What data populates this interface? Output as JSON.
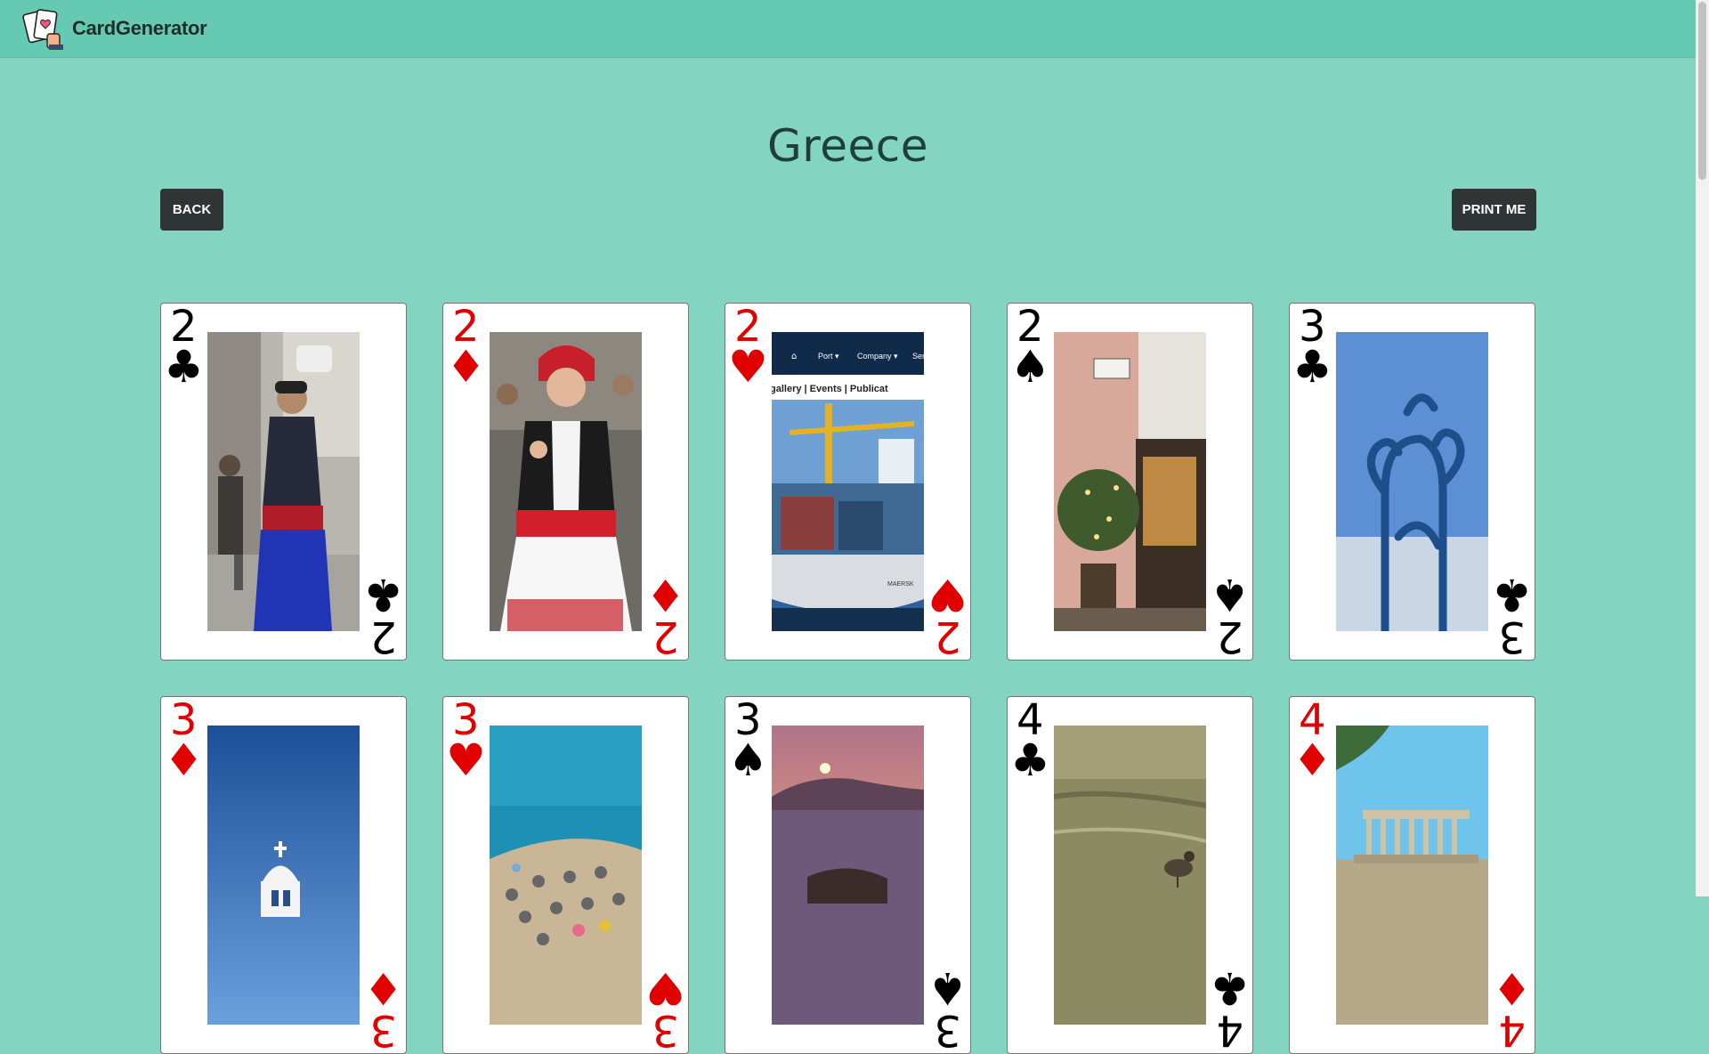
{
  "navbar": {
    "brand": "CardGenerator"
  },
  "page": {
    "title": "Greece"
  },
  "buttons": {
    "back": "BACK",
    "print": "PRINT ME"
  },
  "cards": [
    {
      "rank": "2",
      "suit": "♣",
      "color": "black",
      "photo": "cretan-musician"
    },
    {
      "rank": "2",
      "suit": "♦",
      "color": "red",
      "photo": "woman-in-traditional-dress"
    },
    {
      "rank": "2",
      "suit": "♥",
      "color": "red",
      "photo": "port-website-container-ship"
    },
    {
      "rank": "2",
      "suit": "♠",
      "color": "black",
      "photo": "street-cafe-at-night"
    },
    {
      "rank": "3",
      "suit": "♣",
      "color": "black",
      "photo": "blue-iron-gate"
    },
    {
      "rank": "3",
      "suit": "♦",
      "color": "red",
      "photo": "blue-sky-church-bell-tower"
    },
    {
      "rank": "3",
      "suit": "♥",
      "color": "red",
      "photo": "beach-with-umbrellas"
    },
    {
      "rank": "3",
      "suit": "♠",
      "color": "black",
      "photo": "sunset-over-sea"
    },
    {
      "rank": "4",
      "suit": "♣",
      "color": "black",
      "photo": "bird-in-water"
    },
    {
      "rank": "4",
      "suit": "♦",
      "color": "red",
      "photo": "acropolis"
    }
  ],
  "website_snippet": {
    "menu": [
      "Port ▾",
      "Company ▾",
      "Ser"
    ],
    "subnav": "gallery | Events | Publicat",
    "ship_label": "MAERSK"
  },
  "colors": {
    "background": "#83d5c2",
    "navbar": "#66c9b2",
    "button": "#2e3534",
    "red_suit": "#e00000",
    "black_suit": "#000000"
  }
}
